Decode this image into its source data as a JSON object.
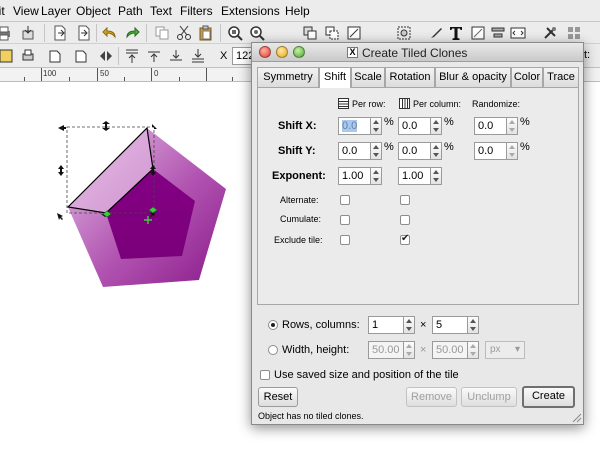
{
  "menubar": {
    "items": [
      "Edit",
      "View",
      "Layer",
      "Object",
      "Path",
      "Text",
      "Filters",
      "Extensions",
      "Help"
    ]
  },
  "toolbar2": {
    "coord_label": "X",
    "coord_value": "122"
  },
  "ruler": {
    "ticks": [
      "100",
      "50",
      "0"
    ]
  },
  "dialog": {
    "title": "Create Tiled Clones",
    "tabs": [
      "Symmetry",
      "Shift",
      "Scale",
      "Rotation",
      "Blur & opacity",
      "Color",
      "Trace"
    ],
    "active_tab": "Shift",
    "columns": {
      "per_row": "Per row:",
      "per_column": "Per column:",
      "randomize": "Randomize:"
    },
    "rows": [
      {
        "label": "Shift X:",
        "per_row": "0.0",
        "per_column": "0.0",
        "randomize": "0.0",
        "unit": "%"
      },
      {
        "label": "Shift Y:",
        "per_row": "0.0",
        "per_column": "0.0",
        "randomize": "0.0",
        "unit": "%"
      },
      {
        "label": "Exponent:",
        "per_row": "1.00",
        "per_column": "1.00"
      }
    ],
    "checks": [
      {
        "label": "Alternate:",
        "per_row": false,
        "per_column": false
      },
      {
        "label": "Cumulate:",
        "per_row": false,
        "per_column": false
      },
      {
        "label": "Exclude tile:",
        "per_row": false,
        "per_column": true
      }
    ],
    "rows_columns": {
      "label": "Rows, columns:",
      "rows": "1",
      "times": "×",
      "columns": "5",
      "selected": true
    },
    "width_height": {
      "label": "Width, height:",
      "width": "50.00",
      "times": "×",
      "height": "50.00",
      "unit": "px",
      "selected": false
    },
    "use_saved": {
      "label": "Use saved size and position of the tile",
      "checked": false
    },
    "buttons": {
      "reset": "Reset",
      "remove": "Remove",
      "unclump": "Unclump",
      "create": "Create"
    },
    "status": "Object has no tiled clones."
  },
  "colors": {
    "accent_dark": "#800080",
    "accent_light": "#d9a6d9",
    "selection_handle": "#000000",
    "node_green": "#3ccf3c"
  }
}
